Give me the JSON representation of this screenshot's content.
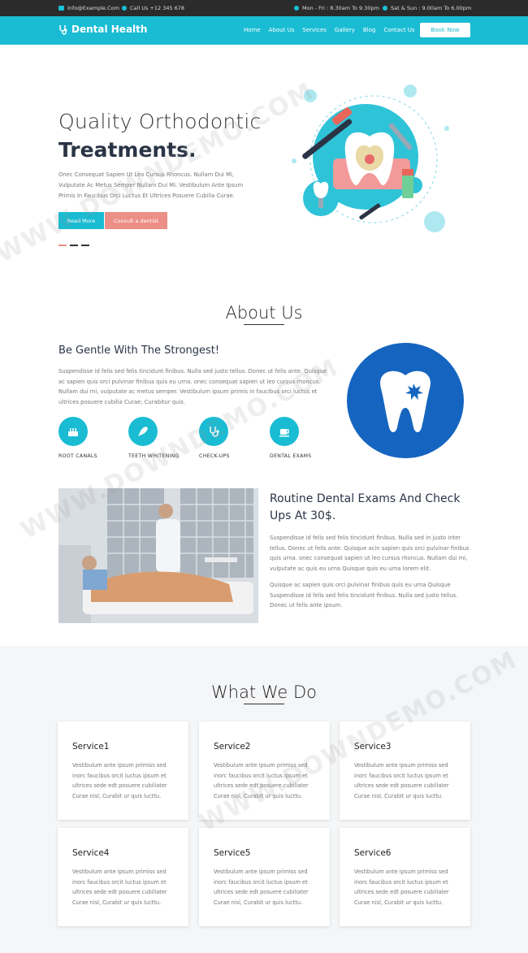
{
  "topbar": {
    "email": "Info@Example.Com",
    "phone": "Call Us +12 345 678",
    "hours_weekday": "Mon - Fri : 8.30am To 9.30pm",
    "hours_weekend": "Sat & Sun : 9.00am To 6.00pm"
  },
  "nav": {
    "logo": "Dental Health",
    "items": [
      "Home",
      "About Us",
      "Services",
      "Gallery",
      "Blog",
      "Contact Us"
    ],
    "cta": "Book Now"
  },
  "hero": {
    "title_light": "Quality Orthodontic",
    "title_bold": "Treatments.",
    "text": "Onec Consequat Sapien Ut Leo Cursus Rhoncus. Nullam Dui Mi, Vulputate Ac Metus Semper Nullam Dui Mi. Vestibulum Ante Ipsum Primis In Faucibus Orci Luctus Et Ultrices Posuere Cubilia Curae.",
    "btn_primary": "Read More",
    "btn_secondary": "Consult a dentist"
  },
  "about": {
    "title": "About Us",
    "heading": "Be Gentle With The Strongest!",
    "text": "Suspendisse id felis sed felis tincidunt finibus. Nulla sed justo tellus. Donec ut felis ante. Quisque ac sapien quis orci pulvinar finibus quis eu urna. onec consequat sapien ut leo cursus rhoncus. Nullam dui mi, vulputate ac metus semper. Vestibulum ipsum primis in faucibus orci luctus et ultrices posuere cubilia Curae; Curabitur quis.",
    "features": [
      {
        "label": "ROOT CANALS",
        "icon": "cake-icon"
      },
      {
        "label": "TEETH WHITENING",
        "icon": "rocket-icon"
      },
      {
        "label": "CHECK-UPS",
        "icon": "stethoscope-icon"
      },
      {
        "label": "DENTAL EXAMS",
        "icon": "cup-icon"
      }
    ]
  },
  "exam": {
    "heading": "Routine Dental Exams And Check Ups At 30$.",
    "text1": "Suspendisse id felis sed felis tincidunt finibus. Nulla sed in justo inter tellus. Donec ut felis ante. Quisque acin sapien quis orci pulvinar finibus quis urna. onec consequat sapien ut leo cursus rhoncus. Nullam dui mi, vulputate ac quis eu urna Quisque quis eu urna lorem elit.",
    "text2": "Quisque ac sapien quis orci pulvinar finibus quis eu urna Quisque Suspendisse id felis sed felis tincidunt finibus. Nulla sed justo tellus. Donec ut felis ante ipsum."
  },
  "services": {
    "title": "What We Do",
    "items": [
      {
        "title": "Service1",
        "text": "Vestibulum ante ipsum primiss sed inorc faucibus orcit luctus ipsum et ultrices sede edt posuere cubiliater Curae nisl, Curabit ur quis lucttu."
      },
      {
        "title": "Service2",
        "text": "Vestibulum ante ipsum primiss sed inorc faucibus orcit luctus ipsum et ultrices sede edt posuere cubiliater Curae nisl, Curabit ur quis lucttu."
      },
      {
        "title": "Service3",
        "text": "Vestibulum ante ipsum primiss sed inorc faucibus orcit luctus ipsum et ultrices sede edt posuere cubiliater Curae nisl, Curabit ur quis lucttu."
      },
      {
        "title": "Service4",
        "text": "Vestibulum ante ipsum primiss sed inorc faucibus orcit luctus ipsum et ultrices sede edt posuere cubiliater Curae nisl, Curabit ur quis lucttu."
      },
      {
        "title": "Service5",
        "text": "Vestibulum ante ipsum primiss sed inorc faucibus orcit luctus ipsum et ultrices sede edt posuere cubiliater Curae nisl, Curabit ur quis lucttu."
      },
      {
        "title": "Service6",
        "text": "Vestibulum ante ipsum primiss sed inorc faucibus orcit luctus ipsum et ultrices sede edt posuere cubiliater Curae nisl, Curabit ur quis lucttu."
      }
    ]
  },
  "watermark": "WWW.DOWNDEMO.COM",
  "colors": {
    "accent": "#19bcd3",
    "coral": "#ec8f86",
    "blue": "#1565c0",
    "dark": "#2b2b2b"
  }
}
